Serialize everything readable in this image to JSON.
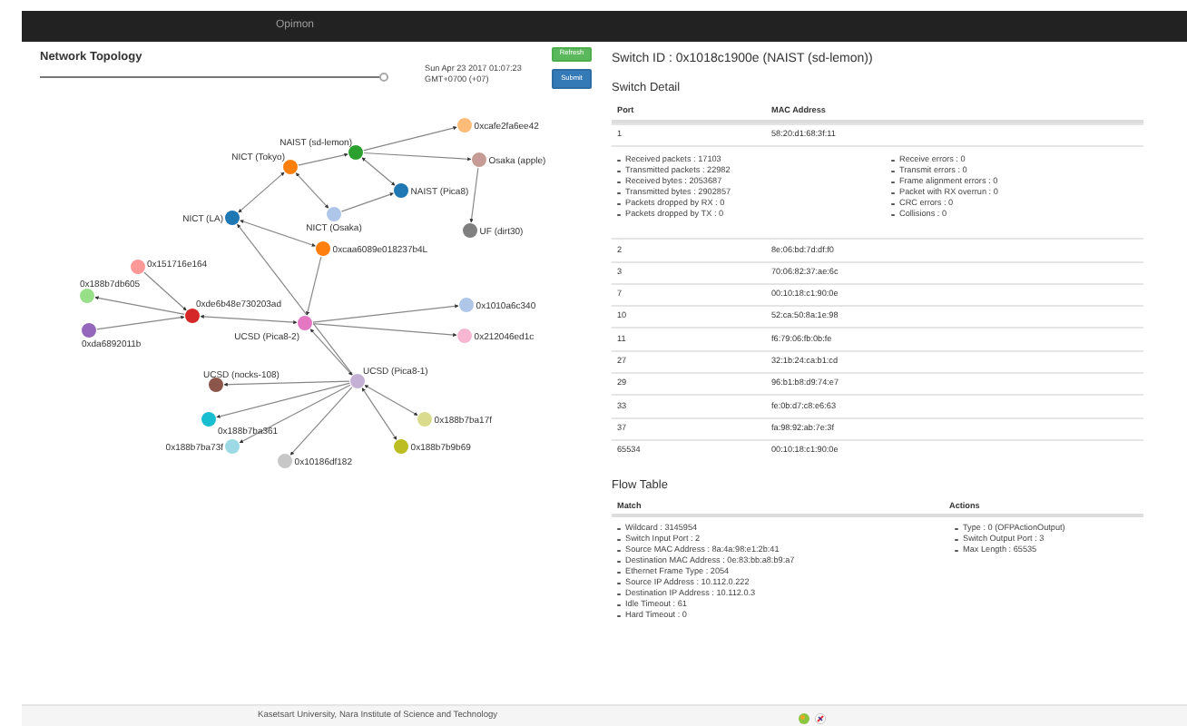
{
  "navbar": {
    "brand": "Opimon"
  },
  "topology": {
    "title": "Network Topology",
    "slider": {
      "level": 1
    },
    "timestamp": [
      "Sun Apr 23 2017 01:07:23",
      "GMT+0700 (+07)"
    ],
    "buttons": [
      {
        "label": "Refresh",
        "kind": "success"
      },
      {
        "label": "Submit",
        "kind": "primary"
      }
    ],
    "nodes": [
      {
        "label": "0xcafe2fa6ee42",
        "color": "#ffbb78"
      },
      {
        "label": "NAIST (sd-lemon)",
        "color": "#2ca02c"
      },
      {
        "label": "Osaka (apple)",
        "color": "#c49c94"
      },
      {
        "label": "NICT (Tokyo)",
        "color": "#ff7f0e"
      },
      {
        "label": "NAIST (Pica8)",
        "color": "#1f77b4"
      },
      {
        "label": "NICT (Osaka)",
        "color": "#aec7e8"
      },
      {
        "label": "NICT (LA)",
        "color": "#1f77b4"
      },
      {
        "label": "UF (dirt30)",
        "color": "#7f7f7f"
      },
      {
        "label": "0xcaa6089e018237b4L",
        "color": "#ff7f0e"
      },
      {
        "label": "0x151716e164",
        "color": "#ff9896"
      },
      {
        "label": "0x188b7db605",
        "color": "#98df8a"
      },
      {
        "label": "0xde6b48e730203ad",
        "color": "#d62728"
      },
      {
        "label": "0xda6892011b",
        "color": "#9467bd"
      },
      {
        "label": "UCSD (Pica8-2)",
        "color": "#e377c2"
      },
      {
        "label": "0x1010a6c340",
        "color": "#aec7e8"
      },
      {
        "label": "0x212046ed1c",
        "color": "#f7b6d2"
      },
      {
        "label": "UCSD (Pica8-1)",
        "color": "#c5b0d5"
      },
      {
        "label": "UCSD (nocks-108)",
        "color": "#8c564b"
      },
      {
        "label": "0x188b7ba17f",
        "color": "#dbdb8d"
      },
      {
        "label": "0x188b7ba361",
        "color": "#17becf"
      },
      {
        "label": "0x188b7ba73f",
        "color": "#9edae5"
      },
      {
        "label": "0x188b7b9b69",
        "color": "#bcbd22"
      },
      {
        "label": "0x10186df182",
        "color": "#c7c7c7"
      }
    ]
  },
  "switch": {
    "title": "Switch ID : 0x1018c1900e (NAIST (sd-lemon))",
    "detail_title": "Switch Detail",
    "columns": [
      "Port",
      "MAC Address"
    ],
    "rows": [
      {
        "port": "1",
        "mac": "58:20:d1:68:3f:11",
        "details": {
          "left": [
            "Received packets : 17103",
            "Transmitted packets : 22982",
            "Received bytes : 2053687",
            "Transmitted bytes : 2902857",
            "Packets dropped by RX : 0",
            "Packets dropped by TX : 0"
          ],
          "right": [
            "Receive errors : 0",
            "Transmit errors : 0",
            "Frame alignment errors : 0",
            "Packet with RX overrun : 0",
            "CRC errors : 0",
            "Collisions : 0"
          ]
        }
      },
      {
        "port": "2",
        "mac": "8e:06:bd:7d:df:f0"
      },
      {
        "port": "3",
        "mac": "70:06:82:37:ae:6c"
      },
      {
        "port": "7",
        "mac": "00:10:18:c1:90:0e"
      },
      {
        "port": "10",
        "mac": "52:ca:50:8a:1e:98"
      },
      {
        "port": "11",
        "mac": "f6:79:06:fb:0b:fe"
      },
      {
        "port": "27",
        "mac": "32:1b:24:ca:b1:cd"
      },
      {
        "port": "29",
        "mac": "96:b1:b8:d9:74:e7"
      },
      {
        "port": "33",
        "mac": "fe:0b:d7:c8:e6:63"
      },
      {
        "port": "37",
        "mac": "fa:98:92:ab:7e:3f"
      },
      {
        "port": "65534",
        "mac": "00:10:18:c1:90:0e"
      }
    ]
  },
  "flow_table": {
    "title": "Flow Table",
    "columns": [
      "Match",
      "Actions"
    ],
    "match": [
      "Wildcard : 3145954",
      "Switch Input Port : 2",
      "Source MAC Address : 8a:4a:98:e1:2b:41",
      "Destination MAC Address : 0e:83:bb:a8:b9:a7",
      "Ethernet Frame Type : 2054",
      "Source IP Address : 10.112.0.222",
      "Destination IP Address : 10.112.0.3",
      "Idle Timeout : 61",
      "Hard Timeout : 0"
    ],
    "actions": [
      "Type : 0 (OFPActionOutput)",
      "Switch Output Port : 3",
      "Max Length : 65535"
    ]
  },
  "footer": {
    "text": "Kasetsart University, Nara Institute of Science and Technology"
  }
}
